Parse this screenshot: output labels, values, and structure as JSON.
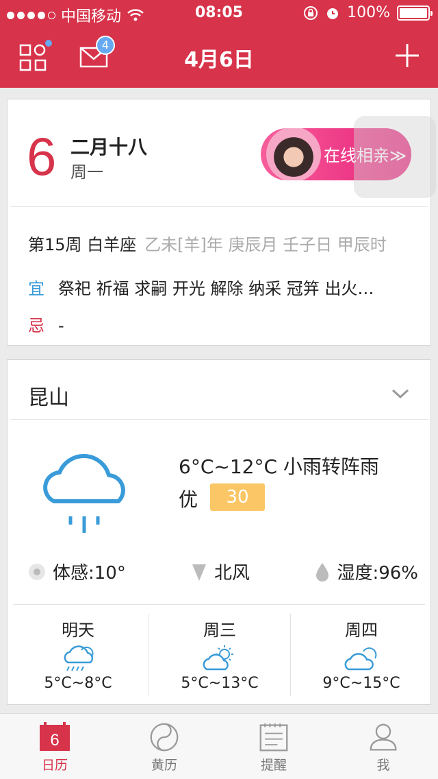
{
  "status_bar": {
    "carrier": "中国移动",
    "time": "08:05",
    "battery": "100%"
  },
  "nav": {
    "title": "4月6日",
    "mail_badge": "4",
    "icons": [
      "grid-apps-icon",
      "mail-icon",
      "plus-icon"
    ]
  },
  "date_card": {
    "day": "6",
    "lunar_date": "二月十八",
    "weekday": "周一",
    "ad_text": "在线相亲≫",
    "week_info": "第15周 白羊座",
    "ganzhi": "乙未[羊]年 庚辰月 壬子日 甲辰时",
    "yi_label": "宜",
    "yi_text": "祭祀 祈福 求嗣 开光 解除  纳采 冠笄 出火…",
    "ji_label": "忌",
    "ji_text": "-"
  },
  "weather": {
    "city": "昆山",
    "temp_range": "6°C~12°C 小雨转阵雨",
    "aq_label": "优",
    "aq_value": "30",
    "feels": "体感:10°",
    "wind": "北风",
    "humidity": "湿度:96%",
    "forecast": [
      {
        "day": "明天",
        "temp": "5°C~8°C",
        "icon": "cloud-rain-icon"
      },
      {
        "day": "周三",
        "temp": "5°C~13°C",
        "icon": "sun-cloud-icon"
      },
      {
        "day": "周四",
        "temp": "9°C~15°C",
        "icon": "cloud-icon"
      }
    ]
  },
  "tabs": [
    {
      "label": "日历",
      "icon_text": "6",
      "active": true
    },
    {
      "label": "黄历"
    },
    {
      "label": "提醒"
    },
    {
      "label": "我"
    }
  ],
  "colors": {
    "brand_red": "#d7334a",
    "accent_blue": "#3a9bd9",
    "aq_yellow": "#fbc665",
    "badge_blue": "#66a9f0"
  }
}
